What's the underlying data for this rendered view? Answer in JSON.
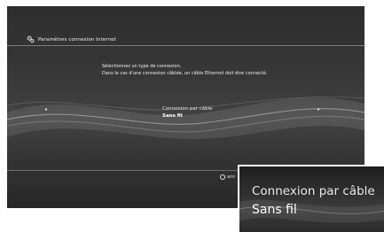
{
  "header": {
    "title": "Paramètres connexion Internet",
    "icon": "settings-gears-icon"
  },
  "instruction": {
    "line1": "Sélectionnez un type de connexion.",
    "line2": "Dans le cas d'une connexion câblée, un câble Ethernet doit être connecté."
  },
  "options": [
    {
      "label": "Connexion par câble",
      "selected": false
    },
    {
      "label": "Sans fil",
      "selected": true
    }
  ],
  "nav": {
    "left_arrow": "◂",
    "right_arrow": "▸"
  },
  "footer": {
    "back_label": "ann",
    "icon": "circle-button-icon"
  },
  "zoom_inset": {
    "option1": "Connexion par câble",
    "option2": "Sans fil"
  }
}
